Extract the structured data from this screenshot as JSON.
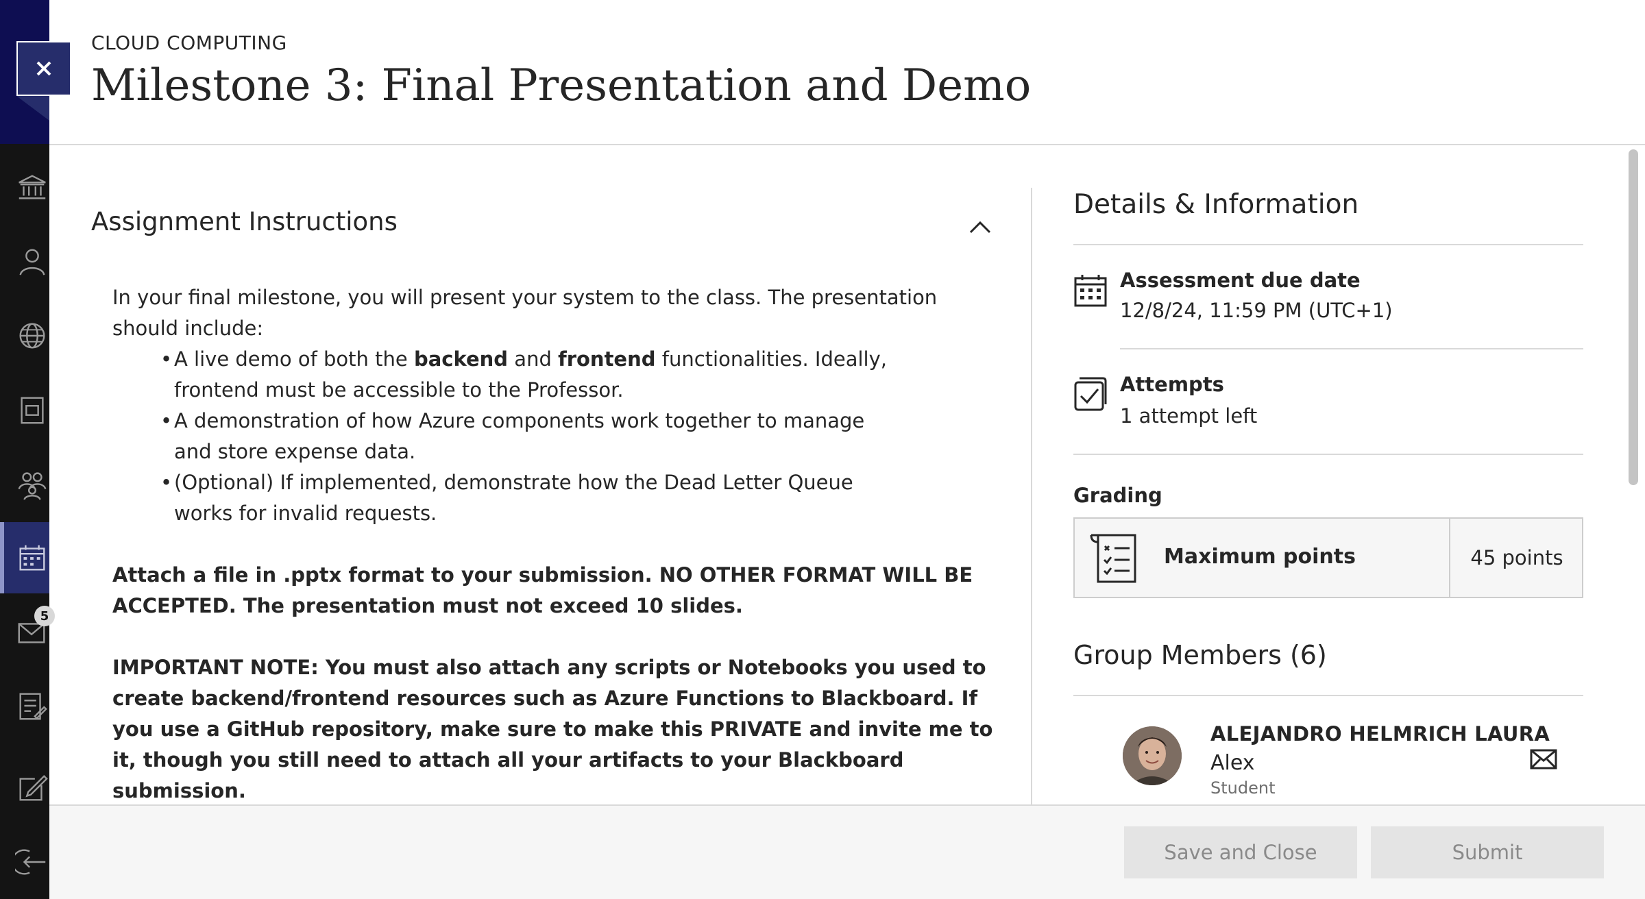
{
  "header": {
    "course_name": "CLOUD COMPUTING",
    "title": "Milestone 3: Final Presentation and Demo"
  },
  "rail": {
    "items": [
      {
        "icon": "institution-icon"
      },
      {
        "icon": "profile-icon"
      },
      {
        "icon": "globe-icon"
      },
      {
        "icon": "courses-icon"
      },
      {
        "icon": "organizations-icon"
      },
      {
        "icon": "calendar-icon",
        "active": true
      },
      {
        "icon": "messages-icon",
        "badge": "5"
      },
      {
        "icon": "grades-icon"
      },
      {
        "icon": "tools-icon"
      },
      {
        "icon": "sign-out-icon"
      }
    ]
  },
  "instructions": {
    "heading": "Assignment Instructions",
    "intro": "In your final milestone, you will present your system to the class. The presentation should include:",
    "bullets": [
      {
        "pre": "A live demo of both the ",
        "bold1": "backend",
        "mid": " and ",
        "bold2": "frontend",
        "post": " functionalities. Ideally, frontend must be accessible to the Professor."
      },
      {
        "text": "A demonstration of how Azure components work together to manage and store expense data."
      },
      {
        "text": "(Optional) If implemented, demonstrate how the Dead Letter Queue works for invalid requests."
      }
    ],
    "attach_note": "Attach a file in .pptx format to your submission. NO OTHER FORMAT WILL BE ACCEPTED. The presentation must not exceed 10 slides.",
    "important_note": "IMPORTANT NOTE: You must also attach any scripts or Notebooks you used to create backend/frontend resources such as Azure Functions to Blackboard. If you use a GitHub repository, make sure to make this PRIVATE and invite me to it, though you still need to attach all your artifacts to your Blackboard submission."
  },
  "details": {
    "title": "Details & Information",
    "due": {
      "label": "Assessment due date",
      "value": "12/8/24, 11:59 PM (UTC+1)"
    },
    "attempts": {
      "label": "Attempts",
      "value": "1 attempt left"
    },
    "grading": {
      "label": "Grading",
      "max_label": "Maximum points",
      "points": "45 points"
    },
    "members": {
      "title": "Group Members (6)",
      "first": {
        "name": "ALEJANDRO HELMRICH LAURA",
        "nickname": "Alex",
        "role": "Student"
      }
    }
  },
  "footer": {
    "save_close_label": "Save and Close",
    "submit_label": "Submit"
  },
  "colors": {
    "rail_bg": "#141414",
    "rail_top": "#0e0e52",
    "accent": "#262d6b",
    "text": "#262626",
    "muted": "#6e6e6e",
    "disabled_btn": "#e4e4e4"
  }
}
